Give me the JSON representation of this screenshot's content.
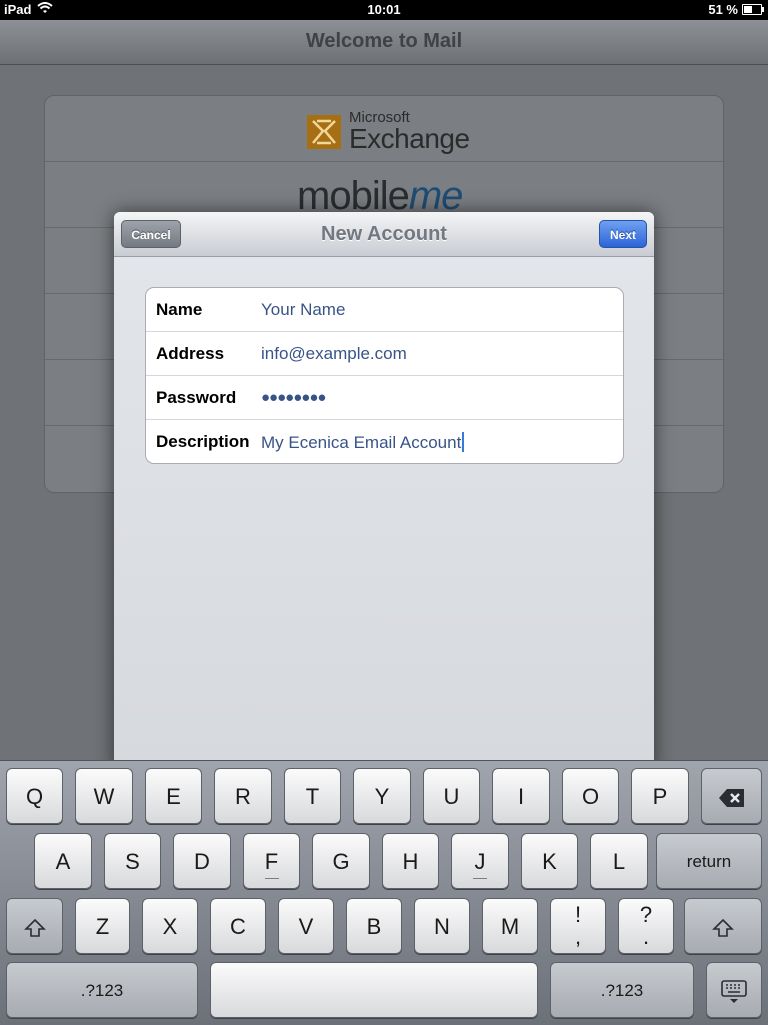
{
  "status": {
    "device": "iPad",
    "time": "10:01",
    "battery": "51 %",
    "battery_level": 0.51
  },
  "background": {
    "title": "Welcome to Mail",
    "providers": {
      "exchange_small": "Microsoft",
      "exchange_big": "Exchange",
      "mobileme_mobile": "mobile",
      "mobileme_me": "me"
    }
  },
  "modal": {
    "title": "New Account",
    "cancel_label": "Cancel",
    "next_label": "Next",
    "fields": [
      {
        "label": "Name",
        "value": "Your Name"
      },
      {
        "label": "Address",
        "value": "info@example.com"
      },
      {
        "label": "Password",
        "value": "●●●●●●●●"
      },
      {
        "label": "Description",
        "value": "My Ecenica Email Account"
      }
    ]
  },
  "keyboard": {
    "row1": [
      "Q",
      "W",
      "E",
      "R",
      "T",
      "Y",
      "U",
      "I",
      "O",
      "P"
    ],
    "row2": [
      "A",
      "S",
      "D",
      "F",
      "G",
      "H",
      "J",
      "K",
      "L"
    ],
    "row3": [
      "Z",
      "X",
      "C",
      "V",
      "B",
      "N",
      "M"
    ],
    "exclam_top": "!",
    "exclam_bottom": ",",
    "question_top": "?",
    "question_bottom": ".",
    "return_label": "return",
    "numbers_label": ".?123",
    "icons": {
      "backspace": "backspace-icon",
      "shift": "shift-icon",
      "hide_keyboard": "hide-keyboard-icon"
    }
  }
}
